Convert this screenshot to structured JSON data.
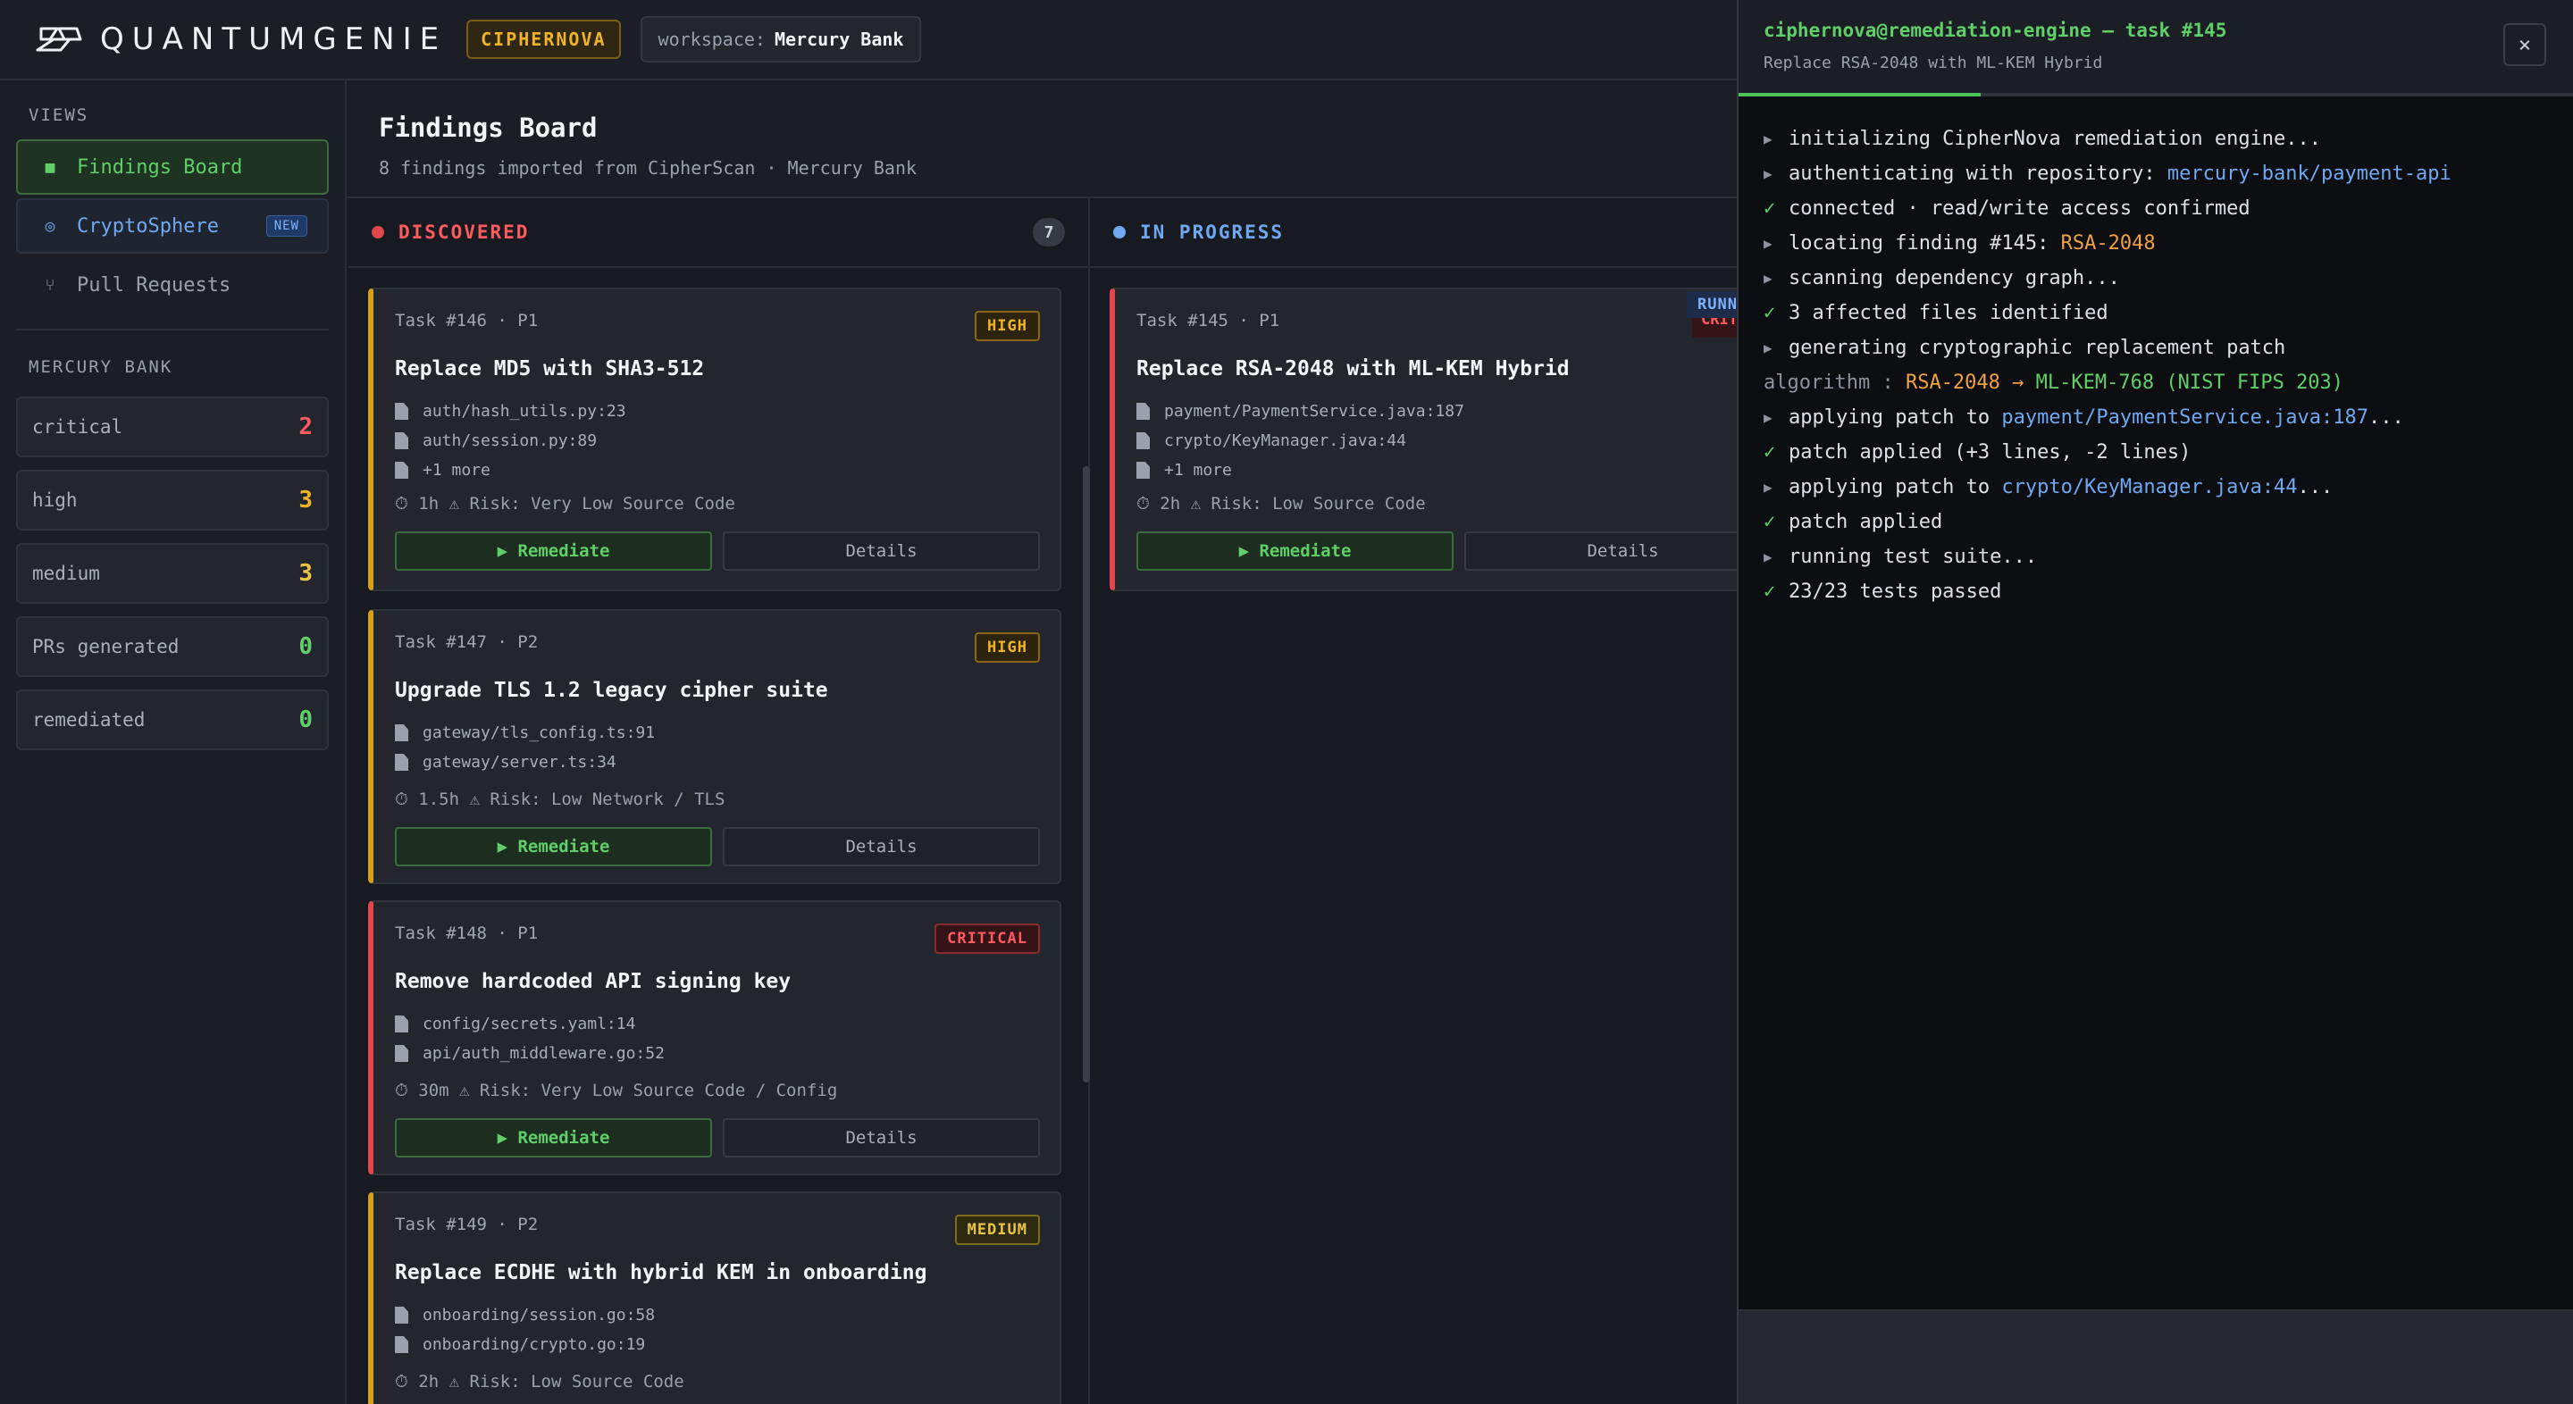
{
  "app": {
    "logo_text": "QUANTUMGENIE",
    "product": "CIPHERNOVA",
    "workspace_label": "workspace:",
    "workspace_value": "Mercury Bank"
  },
  "sidebar": {
    "views_heading": "VIEWS",
    "nav": [
      {
        "label": "Findings Board",
        "icon": "square-icon"
      },
      {
        "label": "CryptoSphere",
        "icon": "orbit-icon",
        "badge": "NEW"
      },
      {
        "label": "Pull Requests",
        "icon": "git-branch-icon"
      }
    ],
    "org_heading": "MERCURY BANK",
    "stats": [
      {
        "label": "critical",
        "value": "2",
        "color": "#ff5a5f"
      },
      {
        "label": "high",
        "value": "3",
        "color": "#f0b429"
      },
      {
        "label": "medium",
        "value": "3",
        "color": "#e8c545"
      },
      {
        "label": "PRs generated",
        "value": "0",
        "color": "#5fd068"
      },
      {
        "label": "remediated",
        "value": "0",
        "color": "#5fd068"
      }
    ]
  },
  "main": {
    "title": "Findings Board",
    "subtitle": "8 findings imported from CipherScan · Mercury Bank"
  },
  "columns": {
    "discovered": {
      "label": "DISCOVERED",
      "count": "7",
      "color": "#e0484d"
    },
    "in_progress": {
      "label": "IN PROGRESS",
      "color": "#6fa8f0",
      "running_tag": "RUNNING",
      "critical_tag": "CRITICAL"
    }
  },
  "cards": {
    "t146": {
      "meta": "Task #146 · P1",
      "severity": "HIGH",
      "title": "Replace MD5 with SHA3-512",
      "files": [
        "auth/hash_utils.py:23",
        "auth/session.py:89",
        "+1 more"
      ],
      "foot": "⏱ 1h  ⚠ Risk: Very Low  Source Code",
      "remediate": "▶ Remediate",
      "details": "Details"
    },
    "t147": {
      "meta": "Task #147 · P2",
      "severity": "HIGH",
      "title": "Upgrade TLS 1.2 legacy cipher suite",
      "files": [
        "gateway/tls_config.ts:91",
        "gateway/server.ts:34"
      ],
      "foot": "⏱ 1.5h  ⚠ Risk: Low  Network / TLS",
      "remediate": "▶ Remediate",
      "details": "Details"
    },
    "t148": {
      "meta": "Task #148 · P1",
      "severity": "CRITICAL",
      "title": "Remove hardcoded API signing key",
      "files": [
        "config/secrets.yaml:14",
        "api/auth_middleware.go:52"
      ],
      "foot": "⏱ 30m  ⚠ Risk: Very Low  Source Code / Config",
      "remediate": "▶ Remediate",
      "details": "Details"
    },
    "t149": {
      "meta": "Task #149 · P2",
      "severity": "MEDIUM",
      "title": "Replace ECDHE with hybrid KEM in onboarding",
      "files": [
        "onboarding/session.go:58",
        "onboarding/crypto.go:19"
      ],
      "foot": "⏱ 2h  ⚠ Risk: Low  Source Code"
    },
    "t145": {
      "meta": "Task #145 · P1",
      "title": "Replace RSA-2048 with ML-KEM Hybrid",
      "files": [
        "payment/PaymentService.java:187",
        "crypto/KeyManager.java:44",
        "+1 more"
      ],
      "foot": "⏱ 2h  ⚠ Risk: Low  Source Code",
      "remediate": "▶ Remediate",
      "details": "Details"
    }
  },
  "terminal": {
    "title": "ciphernova@remediation-engine — task #145",
    "subtitle": "Replace RSA-2048 with ML-KEM Hybrid",
    "close": "×",
    "progress_fraction": 0.29,
    "l1": "initializing CipherNova remediation engine...",
    "l2_a": "authenticating with repository: ",
    "l2_b": "mercury-bank/payment-api",
    "l3": "connected · read/write access confirmed",
    "l4_a": "locating finding #145: ",
    "l4_b": "RSA-2048",
    "l5": "scanning dependency graph...",
    "l6": "3 affected files identified",
    "l7": "generating cryptographic replacement patch",
    "l8_a": "algorithm : ",
    "l8_b": "RSA-2048",
    "l8_c": " → ",
    "l8_d": "ML-KEM-768 (NIST FIPS 203)",
    "l9_a": "applying patch to ",
    "l9_b": "payment/PaymentService.java:187",
    "l9_c": "...",
    "l10": "patch applied (+3 lines, -2 lines)",
    "l11_a": "applying patch to ",
    "l11_b": "crypto/KeyManager.java:44",
    "l11_c": "...",
    "l12": "patch applied",
    "l13": "running test suite...",
    "l14": "23/23 tests passed"
  }
}
